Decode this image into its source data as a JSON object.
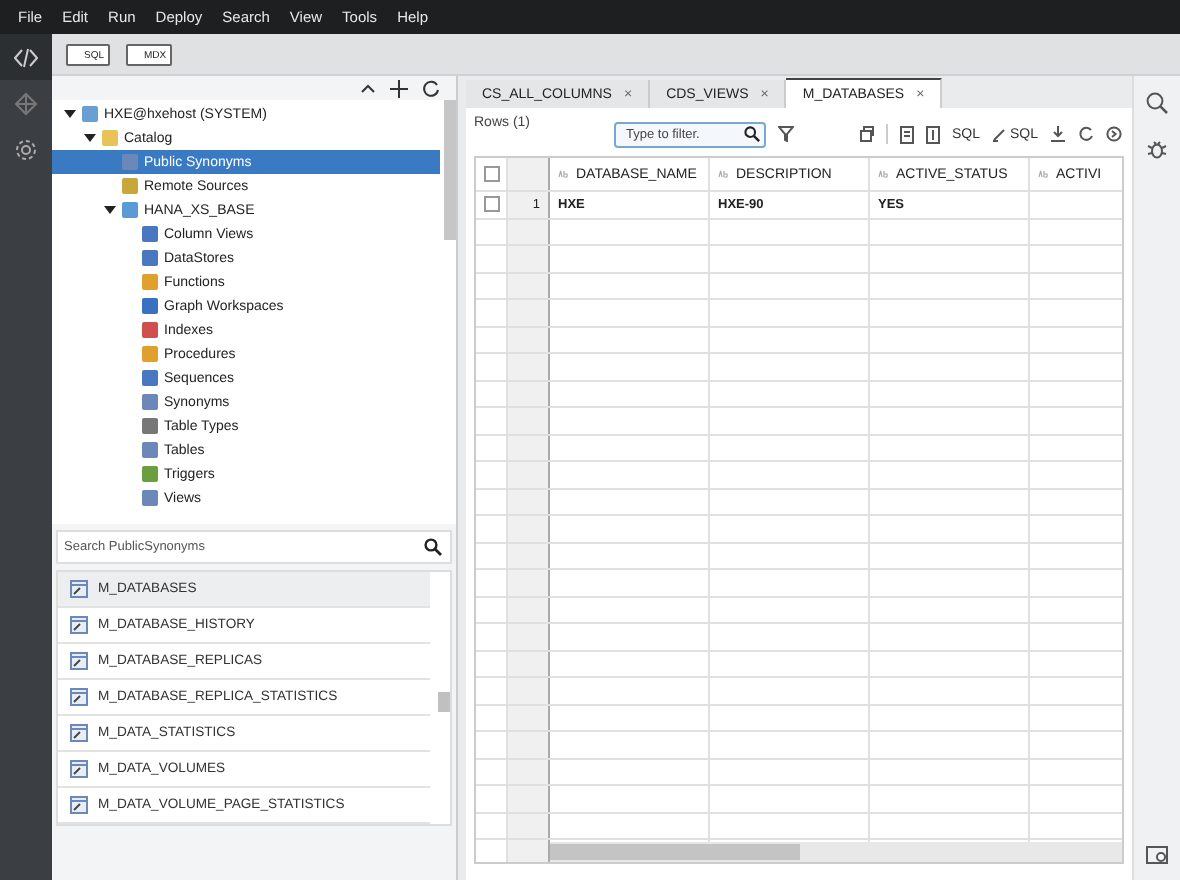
{
  "menu": [
    "File",
    "Edit",
    "Run",
    "Deploy",
    "Search",
    "View",
    "Tools",
    "Help"
  ],
  "toolbar": [
    {
      "label": "SQL"
    },
    {
      "label": "MDX"
    }
  ],
  "activity_bar": [
    {
      "kind": "code",
      "selected": true
    },
    {
      "kind": "network",
      "selected": false
    },
    {
      "kind": "gear",
      "selected": false
    }
  ],
  "tree": [
    {
      "label": "HXE@hxehost (SYSTEM)",
      "kind": "database",
      "selected": false,
      "expanded": true,
      "children": [
        {
          "label": "Catalog",
          "kind": "folder",
          "selected": false,
          "expanded": true,
          "children": [
            {
              "label": "Public Synonyms",
              "kind": "table",
              "selected": true
            },
            {
              "label": "Remote Sources",
              "kind": "remote",
              "selected": false
            },
            {
              "label": "HANA_XS_BASE",
              "kind": "schema",
              "selected": false,
              "expanded": true,
              "children": [
                {
                  "label": "Column Views",
                  "kind": "columns",
                  "selected": false
                },
                {
                  "label": "DataStores",
                  "kind": "datastore",
                  "selected": false
                },
                {
                  "label": "Functions",
                  "kind": "function",
                  "selected": false
                },
                {
                  "label": "Graph Workspaces",
                  "kind": "graph",
                  "selected": false
                },
                {
                  "label": "Indexes",
                  "kind": "index",
                  "selected": false
                },
                {
                  "label": "Procedures",
                  "kind": "procedure",
                  "selected": false
                },
                {
                  "label": "Sequences",
                  "kind": "sequence",
                  "selected": false
                },
                {
                  "label": "Synonyms",
                  "kind": "table",
                  "selected": false
                },
                {
                  "label": "Table Types",
                  "kind": "tabletype",
                  "selected": false
                },
                {
                  "label": "Tables",
                  "kind": "table",
                  "selected": false
                },
                {
                  "label": "Triggers",
                  "kind": "trigger",
                  "selected": false
                },
                {
                  "label": "Views",
                  "kind": "table",
                  "selected": false
                }
              ]
            }
          ]
        }
      ]
    }
  ],
  "search": {
    "placeholder": "Search PublicSynonyms"
  },
  "synonyms": [
    {
      "label": "M_DATABASES",
      "selected": true
    },
    {
      "label": "M_DATABASE_HISTORY",
      "selected": false
    },
    {
      "label": "M_DATABASE_REPLICAS",
      "selected": false
    },
    {
      "label": "M_DATABASE_REPLICA_STATISTICS",
      "selected": false
    },
    {
      "label": "M_DATA_STATISTICS",
      "selected": false
    },
    {
      "label": "M_DATA_VOLUMES",
      "selected": false
    },
    {
      "label": "M_DATA_VOLUME_PAGE_STATISTICS",
      "selected": false
    }
  ],
  "tabs": [
    {
      "label": "CS_ALL_COLUMNS",
      "close": "×",
      "selected": false
    },
    {
      "label": "CDS_VIEWS",
      "close": "×",
      "selected": false
    },
    {
      "label": "M_DATABASES",
      "close": "×",
      "selected": true
    }
  ],
  "result": {
    "rows_label": "Rows (1)",
    "filter_placeholder": "Type to filter.",
    "actions": [
      {
        "kind": "copy"
      },
      {
        "kind": "sep"
      },
      {
        "kind": "export"
      },
      {
        "kind": "info"
      },
      {
        "kind": "text",
        "label": "SQL"
      },
      {
        "kind": "edit",
        "label": "SQL"
      },
      {
        "kind": "download"
      },
      {
        "kind": "refresh"
      },
      {
        "kind": "next"
      }
    ]
  },
  "table": {
    "select_all_checked": false,
    "columns": [
      "DATABASE_NAME",
      "DESCRIPTION",
      "ACTIVE_STATUS",
      "ACTIVI"
    ],
    "rows": [
      {
        "checked": false,
        "number": "1",
        "cells": [
          "HXE",
          "HXE-90",
          "YES"
        ]
      }
    ]
  }
}
